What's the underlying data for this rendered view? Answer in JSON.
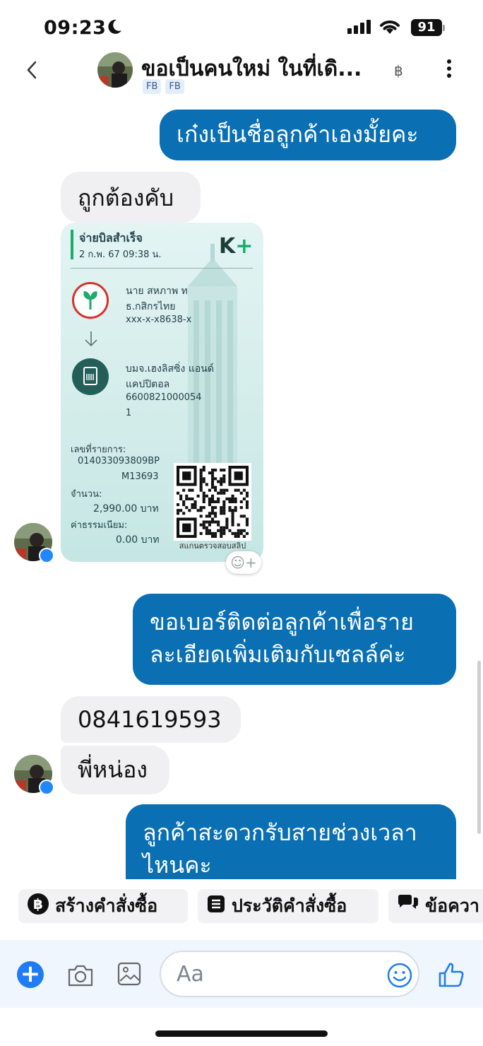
{
  "status_bar": {
    "time": "09:23",
    "battery": "91"
  },
  "header": {
    "title": "ขอเป็นคนใหม่ ในที่เดิ...",
    "badges": [
      "FB",
      "FB"
    ],
    "currency_icon": "฿"
  },
  "messages": [
    {
      "from": "me",
      "text": "เก๋งเป็นชื่อลูกค้าเองมั้ยคะ"
    },
    {
      "from": "them",
      "text": "ถูกต้องคับ"
    },
    {
      "from": "them",
      "type": "image",
      "receipt": {
        "title": "จ่ายบิลสำเร็จ",
        "datetime": "2 ก.พ. 67  09:38 น.",
        "brand_k": "K",
        "brand_plus": "+",
        "from_name": "นาย สหภาพ ท",
        "from_bank": "ธ.กสิกรไทย",
        "from_account": "xxx-x-x8638-x",
        "to_name_1": "บมจ.เฮงลิสซิ่ง แอนด์",
        "to_name_2": "แคปปิตอล",
        "to_account_1": "6600821000054",
        "to_account_2": "1",
        "ref_label": "เลขที่รายการ:",
        "ref_1": "014033093809BP",
        "ref_2": "M13693",
        "amount_label": "จำนวน:",
        "amount": "2,990.00 บาท",
        "fee_label": "ค่าธรรมเนียม:",
        "fee": "0.00 บาท",
        "qr_caption": "สแกนตรวจสอบสลิป"
      }
    },
    {
      "from": "me",
      "lines": [
        "ขอเบอร์ติดต่อลูกค้าเพื่อราย",
        "ละเอียดเพิ่มเติมกับเซลล์ค่ะ"
      ]
    },
    {
      "from": "them",
      "text": "0841619593"
    },
    {
      "from": "them",
      "text": "พี่หน่อง"
    },
    {
      "from": "me",
      "lines": [
        "ลูกค้าสะดวกรับสายช่วงเวลา",
        "ไหนคะ"
      ]
    }
  ],
  "quick_actions": [
    {
      "icon": "baht-icon",
      "label": "สร้างคำสั่งซื้อ"
    },
    {
      "icon": "order-history-icon",
      "label": "ประวัติคำสั่งซื้อ"
    },
    {
      "icon": "chat-bubbles-icon",
      "label": "ข้อควา"
    }
  ],
  "composer": {
    "placeholder": "Aa"
  },
  "colors": {
    "outgoing_bubble": "#0a6fb3",
    "incoming_bubble": "#f0f0f2",
    "accent": "#1f7cf5"
  }
}
